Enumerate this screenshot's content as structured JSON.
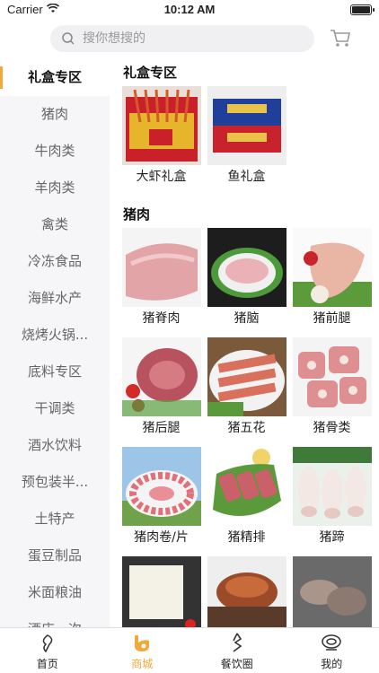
{
  "status": {
    "carrier": "Carrier",
    "time": "10:12 AM"
  },
  "search": {
    "placeholder": "搜你想搜的"
  },
  "sidebar": {
    "items": [
      "礼盒专区",
      "猪肉",
      "牛肉类",
      "羊肉类",
      "禽类",
      "冷冻食品",
      "海鲜水产",
      "烧烤火锅...",
      "底料专区",
      "干调类",
      "酒水饮料",
      "预包装半...",
      "土特产",
      "蛋豆制品",
      "米面粮油",
      "酒店一次"
    ]
  },
  "sections": [
    {
      "title": "礼盒专区",
      "items": [
        "大虾礼盒",
        "鱼礼盒"
      ]
    },
    {
      "title": "猪肉",
      "items": [
        "猪脊肉",
        "猪脑",
        "猪前腿",
        "猪后腿",
        "猪五花",
        "猪骨类",
        "猪肉卷/片",
        "猪精排",
        "猪蹄"
      ]
    }
  ],
  "tabbar": {
    "items": [
      "首页",
      "商城",
      "餐饮圈",
      "我的"
    ],
    "active": 1
  },
  "colors": {
    "accent": "#f0a93b",
    "sidebar_bg": "#f6f6f8"
  }
}
